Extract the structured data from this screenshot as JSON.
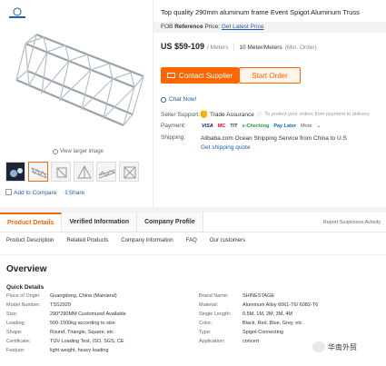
{
  "product": {
    "title": "Top quality 290mm aluminum frame Event Spigot Aluminum Truss",
    "fob_label": "FOB",
    "fob_ref": "Reference",
    "fob_price_word": "Price:",
    "fob_link": "Get Latest Price",
    "price": "US $59-109",
    "price_unit": "/ Meters",
    "moq": "10 Meter/Meters",
    "moq_note": "(Min. Order)",
    "contact_button": "Contact Supplier",
    "start_order_button": "Start Order",
    "chat_now": "Chat Now!"
  },
  "gallery": {
    "view_larger": "View larger image",
    "add_to_compare": "Add to Compare",
    "share": "Share"
  },
  "attributes": {
    "seller_support_label": "Seller Support:",
    "trade_assurance": "Trade Assurance",
    "trade_assurance_note": "To protect your orders from payment to delivery",
    "payment_label": "Payment:",
    "payment_methods": [
      "VISA",
      "MC",
      "T/T",
      "e-Checking",
      "Pay Later",
      "More"
    ],
    "shipping_label": "Shipping:",
    "shipping_text": "Alibaba.com Ocean Shipping Service from China to U.S",
    "shipping_link": "Get shipping quote"
  },
  "tabs": {
    "items": [
      "Product Details",
      "Verified Information",
      "Company Profile"
    ],
    "report": "Report Suspicious Activity"
  },
  "subnav": [
    "Product Description",
    "Related Products",
    "Company Information",
    "FAQ",
    "Our customers"
  ],
  "overview": {
    "heading": "Overview",
    "quick_details": "Quick Details",
    "left": [
      {
        "k": "Place of Origin:",
        "v": "Guangdong, China (Mainland)"
      },
      {
        "k": "Model Number:",
        "v": "TSS2929"
      },
      {
        "k": "Size:",
        "v": "290*290MM Customized Available"
      },
      {
        "k": "Loading:",
        "v": "500-1500kg according to size"
      },
      {
        "k": "Shape:",
        "v": "Round, Triangle, Square, etc"
      },
      {
        "k": "Certificate:",
        "v": "TUV Loading Test, ISO, SGS, CE"
      },
      {
        "k": "Feature:",
        "v": "light weight, heavy loading"
      }
    ],
    "right": [
      {
        "k": "Brand Name:",
        "v": "SHINESTAGE"
      },
      {
        "k": "Material:",
        "v": "Aluminum Alloy 6061-T6/ 6082-T6"
      },
      {
        "k": "Single Length:",
        "v": "0.5M, 1M, 2M, 3M, 4M"
      },
      {
        "k": "Color:",
        "v": "Black, Red, Blue, Grey, etc"
      },
      {
        "k": "Type:",
        "v": "Spigot Connecting"
      },
      {
        "k": "Application:",
        "v": "concert"
      }
    ]
  },
  "watermark": "华南外贸",
  "colors": {
    "accent": "#ff6600",
    "link": "#1a5fb4"
  }
}
